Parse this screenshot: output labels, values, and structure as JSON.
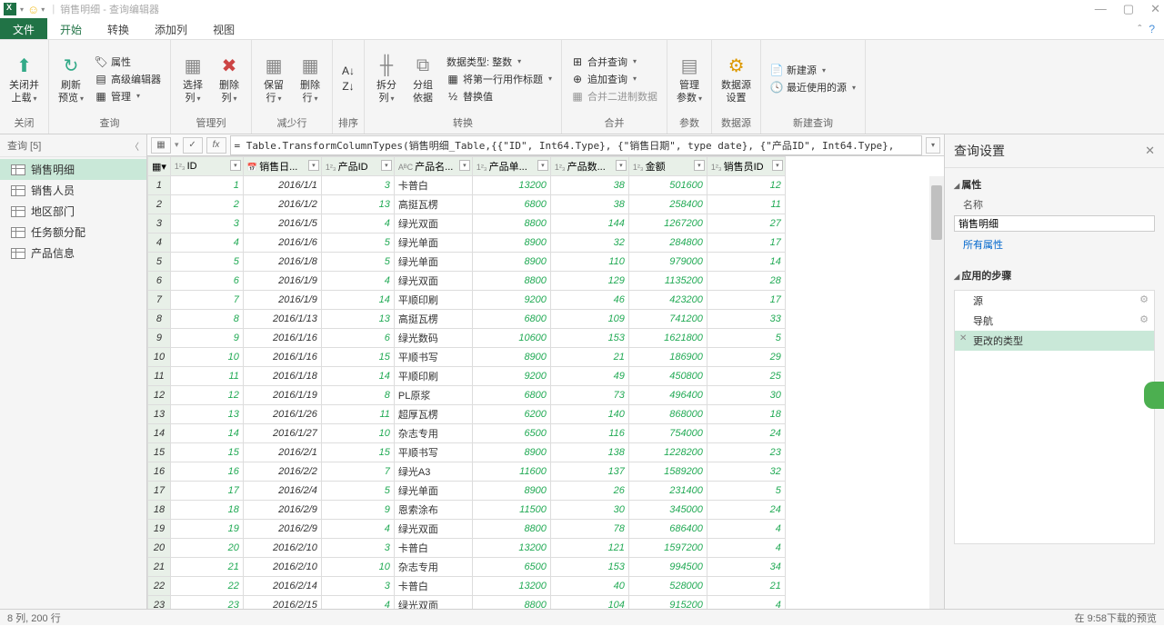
{
  "titlebar": {
    "title": "销售明细 - 查询编辑器",
    "minimize": "—",
    "maximize": "▢",
    "close": "✕"
  },
  "tabs": {
    "file": "文件",
    "home": "开始",
    "transform": "转换",
    "addColumn": "添加列",
    "view": "视图"
  },
  "ribbon": {
    "closeGroup": {
      "closeLoad": "关闭并\n上载",
      "label": "关闭"
    },
    "queryGroup": {
      "refresh": "刷新\n预览",
      "properties": "属性",
      "advEditor": "高级编辑器",
      "manage": "管理",
      "label": "查询"
    },
    "colGroup": {
      "chooseCols": "选择\n列",
      "removeCols": "删除\n列",
      "label": "管理列"
    },
    "rowGroup": {
      "keepRows": "保留\n行",
      "removeRows": "删除\n行",
      "label": "减少行"
    },
    "sortGroup": {
      "label": "排序"
    },
    "transformGroup": {
      "splitCol": "拆分\n列",
      "groupBy": "分组\n依据",
      "dataType": "数据类型: 整数",
      "firstRowHeader": "将第一行用作标题",
      "replaceValues": "替换值",
      "label": "转换"
    },
    "combineGroup": {
      "merge": "合并查询",
      "append": "追加查询",
      "combineBinary": "合并二进制数据",
      "label": "合并"
    },
    "paramGroup": {
      "manageParams": "管理\n参数",
      "label": "参数"
    },
    "dataSrcGroup": {
      "dataSrcSettings": "数据源\n设置",
      "label": "数据源"
    },
    "newQueryGroup": {
      "newSource": "新建源",
      "recentSources": "最近使用的源",
      "label": "新建查询"
    }
  },
  "queries": {
    "header": "查询 [5]",
    "items": [
      "销售明细",
      "销售人员",
      "地区部门",
      "任务额分配",
      "产品信息"
    ]
  },
  "formula": {
    "fx": "fx",
    "text": "= Table.TransformColumnTypes(销售明细_Table,{{\"ID\", Int64.Type}, {\"销售日期\", type date}, {\"产品ID\", Int64.Type},"
  },
  "columns": [
    "ID",
    "销售日...",
    "产品ID",
    "产品名...",
    "产品单...",
    "产品数...",
    "金额",
    "销售员ID"
  ],
  "colTypes": [
    "1²₃",
    "📅",
    "1²₃",
    "AᴮC",
    "1²₃",
    "1²₃",
    "1²₃",
    "1²₃"
  ],
  "rows": [
    [
      1,
      "2016/1/1",
      3,
      "卡普白",
      13200,
      38,
      501600,
      12
    ],
    [
      2,
      "2016/1/2",
      13,
      "高挺瓦楞",
      6800,
      38,
      258400,
      11
    ],
    [
      3,
      "2016/1/5",
      4,
      "绿光双面",
      8800,
      144,
      1267200,
      27
    ],
    [
      4,
      "2016/1/6",
      5,
      "绿光单面",
      8900,
      32,
      284800,
      17
    ],
    [
      5,
      "2016/1/8",
      5,
      "绿光单面",
      8900,
      110,
      979000,
      14
    ],
    [
      6,
      "2016/1/9",
      4,
      "绿光双面",
      8800,
      129,
      1135200,
      28
    ],
    [
      7,
      "2016/1/9",
      14,
      "平顺印刷",
      9200,
      46,
      423200,
      17
    ],
    [
      8,
      "2016/1/13",
      13,
      "高挺瓦楞",
      6800,
      109,
      741200,
      33
    ],
    [
      9,
      "2016/1/16",
      6,
      "绿光数码",
      10600,
      153,
      1621800,
      5
    ],
    [
      10,
      "2016/1/16",
      15,
      "平顺书写",
      8900,
      21,
      186900,
      29
    ],
    [
      11,
      "2016/1/18",
      14,
      "平顺印刷",
      9200,
      49,
      450800,
      25
    ],
    [
      12,
      "2016/1/19",
      8,
      "PL原浆",
      6800,
      73,
      496400,
      30
    ],
    [
      13,
      "2016/1/26",
      11,
      "超厚瓦楞",
      6200,
      140,
      868000,
      18
    ],
    [
      14,
      "2016/1/27",
      10,
      "杂志专用",
      6500,
      116,
      754000,
      24
    ],
    [
      15,
      "2016/2/1",
      15,
      "平顺书写",
      8900,
      138,
      1228200,
      23
    ],
    [
      16,
      "2016/2/2",
      7,
      "绿光A3",
      11600,
      137,
      1589200,
      32
    ],
    [
      17,
      "2016/2/4",
      5,
      "绿光单面",
      8900,
      26,
      231400,
      5
    ],
    [
      18,
      "2016/2/9",
      9,
      "恩索涂布",
      11500,
      30,
      345000,
      24
    ],
    [
      19,
      "2016/2/9",
      4,
      "绿光双面",
      8800,
      78,
      686400,
      4
    ],
    [
      20,
      "2016/2/10",
      3,
      "卡普白",
      13200,
      121,
      1597200,
      4
    ],
    [
      21,
      "2016/2/10",
      10,
      "杂志专用",
      6500,
      153,
      994500,
      34
    ],
    [
      22,
      "2016/2/14",
      3,
      "卡普白",
      13200,
      40,
      528000,
      21
    ],
    [
      23,
      "2016/2/15",
      4,
      "绿光双面",
      8800,
      104,
      915200,
      4
    ]
  ],
  "settings": {
    "header": "查询设置",
    "propSection": "属性",
    "nameLabel": "名称",
    "nameValue": "销售明细",
    "allProps": "所有属性",
    "stepsSection": "应用的步骤",
    "steps": [
      "源",
      "导航",
      "更改的类型"
    ]
  },
  "status": {
    "left": "8 列, 200 行",
    "right": "在 9:58下载的预览"
  }
}
